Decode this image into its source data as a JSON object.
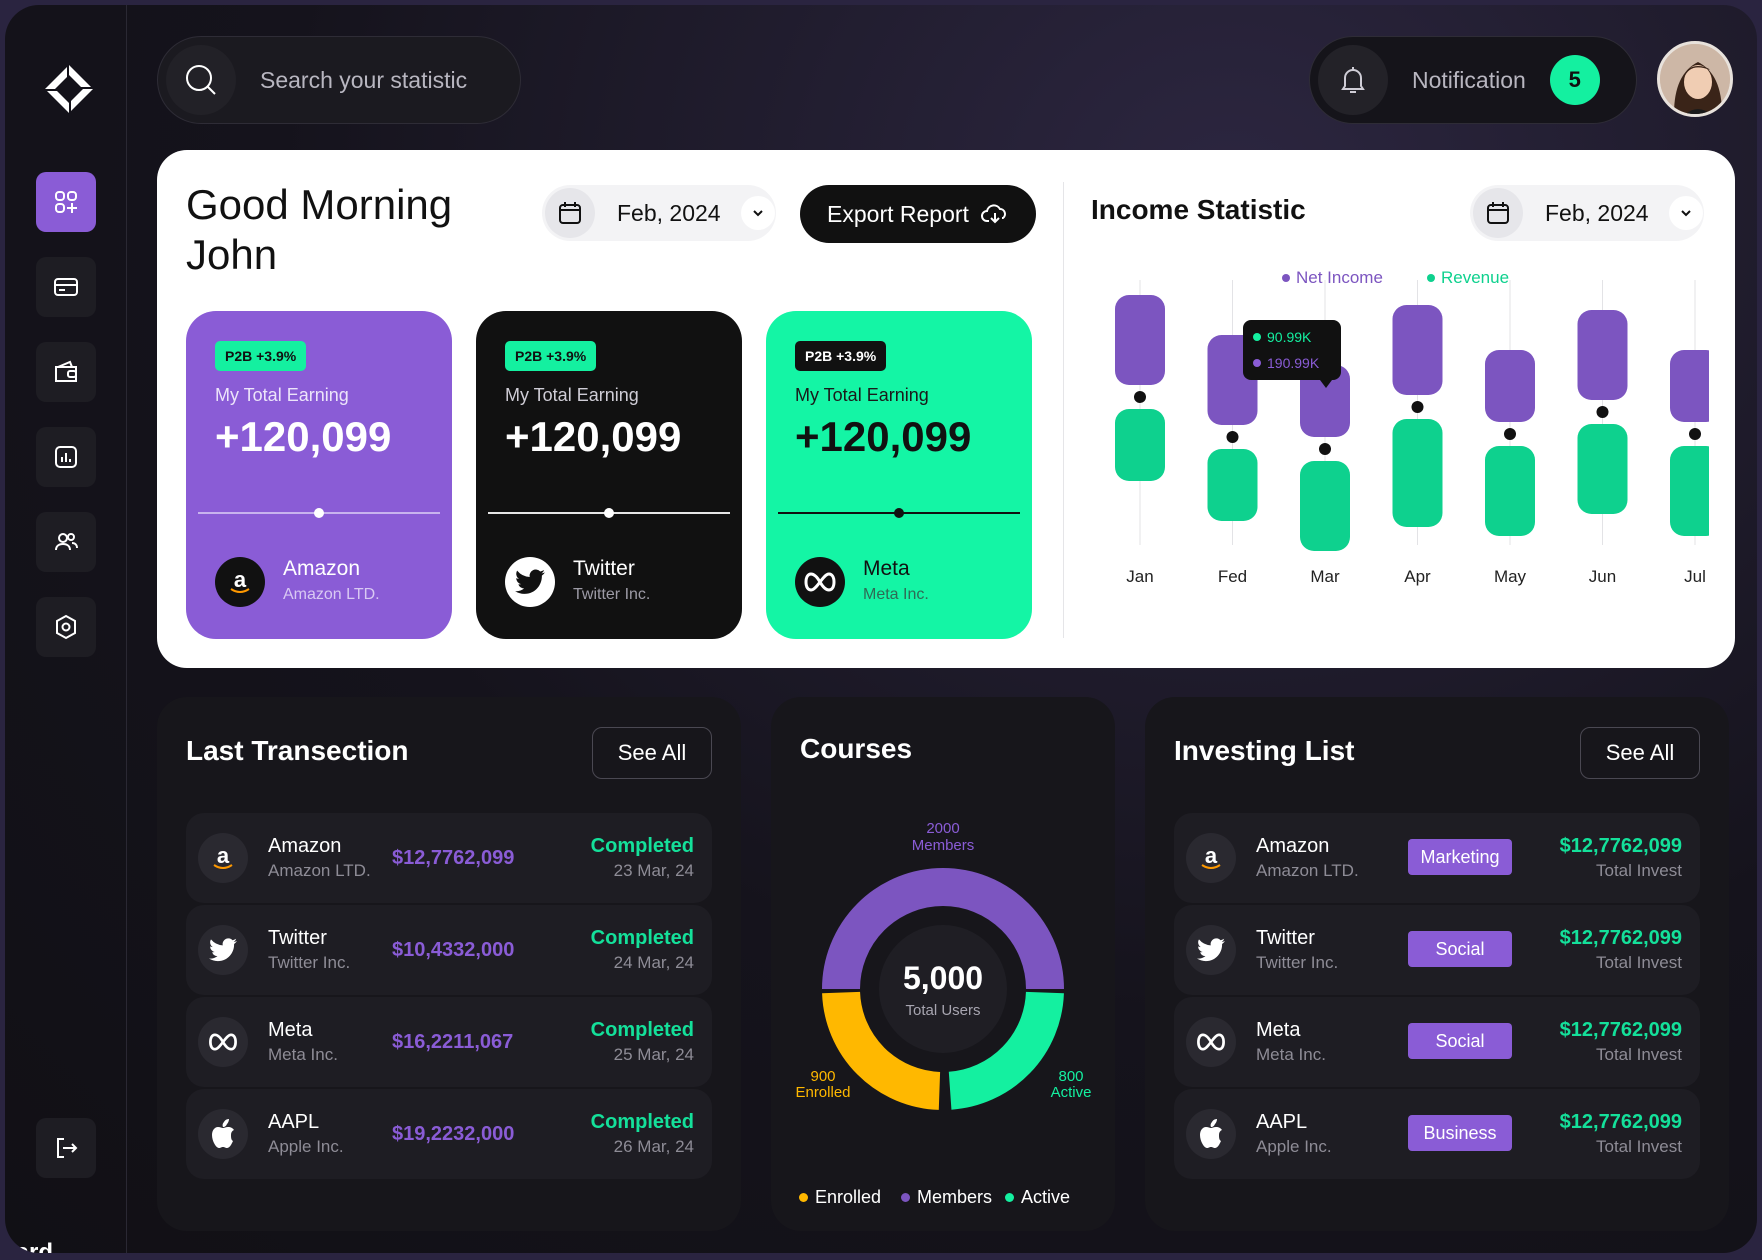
{
  "search": {
    "placeholder": "Search your statistic"
  },
  "notification": {
    "label": "Notification",
    "count": "5"
  },
  "sidebar": {
    "items": [
      {
        "name": "dashboard-icon"
      },
      {
        "name": "card-icon"
      },
      {
        "name": "wallet-icon"
      },
      {
        "name": "chart-icon"
      },
      {
        "name": "users-icon"
      },
      {
        "name": "settings-icon"
      }
    ],
    "logout": "logout-icon",
    "caption": "oard"
  },
  "greeting": {
    "line1": "Good Morning",
    "line2": "John"
  },
  "date_filter": {
    "value": "Feb, 2024"
  },
  "export": {
    "label": "Export Report"
  },
  "earning_cards": [
    {
      "tag": "P2B +3.9%",
      "label": "My Total Earning",
      "value": "+120,099",
      "company": "Amazon",
      "company_sub": "Amazon LTD.",
      "theme": "purple"
    },
    {
      "tag": "P2B +3.9%",
      "label": "My Total Earning",
      "value": "+120,099",
      "company": "Twitter",
      "company_sub": "Twitter Inc.",
      "theme": "black"
    },
    {
      "tag": "P2B +3.9%",
      "label": "My Total Earning",
      "value": "+120,099",
      "company": "Meta",
      "company_sub": "Meta Inc.",
      "theme": "green"
    }
  ],
  "income": {
    "title": "Income Statistic",
    "date": "Feb, 2024",
    "tooltip": {
      "revenue": "90.99K",
      "net_income": "190.99K"
    }
  },
  "chart_data": {
    "type": "bar",
    "categories": [
      "Jan",
      "Fed",
      "Mar",
      "Apr",
      "May",
      "Jun",
      "Jul"
    ],
    "series": [
      {
        "name": "Net Income",
        "color": "#7c55c0",
        "values": [
          5,
          5,
          4,
          5,
          4,
          5,
          4
        ]
      },
      {
        "name": "Revenue",
        "color": "#0ed18e",
        "values": [
          4,
          4,
          5,
          6,
          5,
          5,
          5
        ]
      }
    ]
  },
  "transactions": {
    "title": "Last Transection",
    "see_all": "See All",
    "rows": [
      {
        "name": "Amazon",
        "sub": "Amazon LTD.",
        "amount": "$12,7762,099",
        "status": "Completed",
        "date": "23 Mar, 24",
        "icon": "amazon-icon"
      },
      {
        "name": "Twitter",
        "sub": "Twitter Inc.",
        "amount": "$10,4332,000",
        "status": "Completed",
        "date": "24 Mar, 24",
        "icon": "twitter-icon"
      },
      {
        "name": "Meta",
        "sub": "Meta Inc.",
        "amount": "$16,2211,067",
        "status": "Completed",
        "date": "25 Mar, 24",
        "icon": "meta-icon"
      },
      {
        "name": "AAPL",
        "sub": "Apple Inc.",
        "amount": "$19,2232,000",
        "status": "Completed",
        "date": "26 Mar, 24",
        "icon": "apple-icon"
      }
    ]
  },
  "courses": {
    "title": "Courses",
    "total": "5,000",
    "total_label": "Total Users",
    "members_value": "2000",
    "members_label": "Members",
    "enrolled_value": "900",
    "enrolled_label": "Enrolled",
    "active_value": "800",
    "active_label": "Active",
    "legend": [
      "Enrolled",
      "Members",
      "Active"
    ],
    "colors": {
      "enrolled": "#ffb800",
      "members": "#7c55c0",
      "active": "#14f0a0"
    }
  },
  "investing": {
    "title": "Investing List",
    "see_all": "See All",
    "rows": [
      {
        "name": "Amazon",
        "sub": "Amazon LTD.",
        "category": "Marketing",
        "amount": "$12,7762,099",
        "label": "Total Invest",
        "icon": "amazon-icon"
      },
      {
        "name": "Twitter",
        "sub": "Twitter Inc.",
        "category": "Social",
        "amount": "$12,7762,099",
        "label": "Total Invest",
        "icon": "twitter-icon"
      },
      {
        "name": "Meta",
        "sub": "Meta Inc.",
        "category": "Social",
        "amount": "$12,7762,099",
        "label": "Total Invest",
        "icon": "meta-icon"
      },
      {
        "name": "AAPL",
        "sub": "Apple Inc.",
        "category": "Business",
        "amount": "$12,7762,099",
        "label": "Total Invest",
        "icon": "apple-icon"
      }
    ]
  }
}
